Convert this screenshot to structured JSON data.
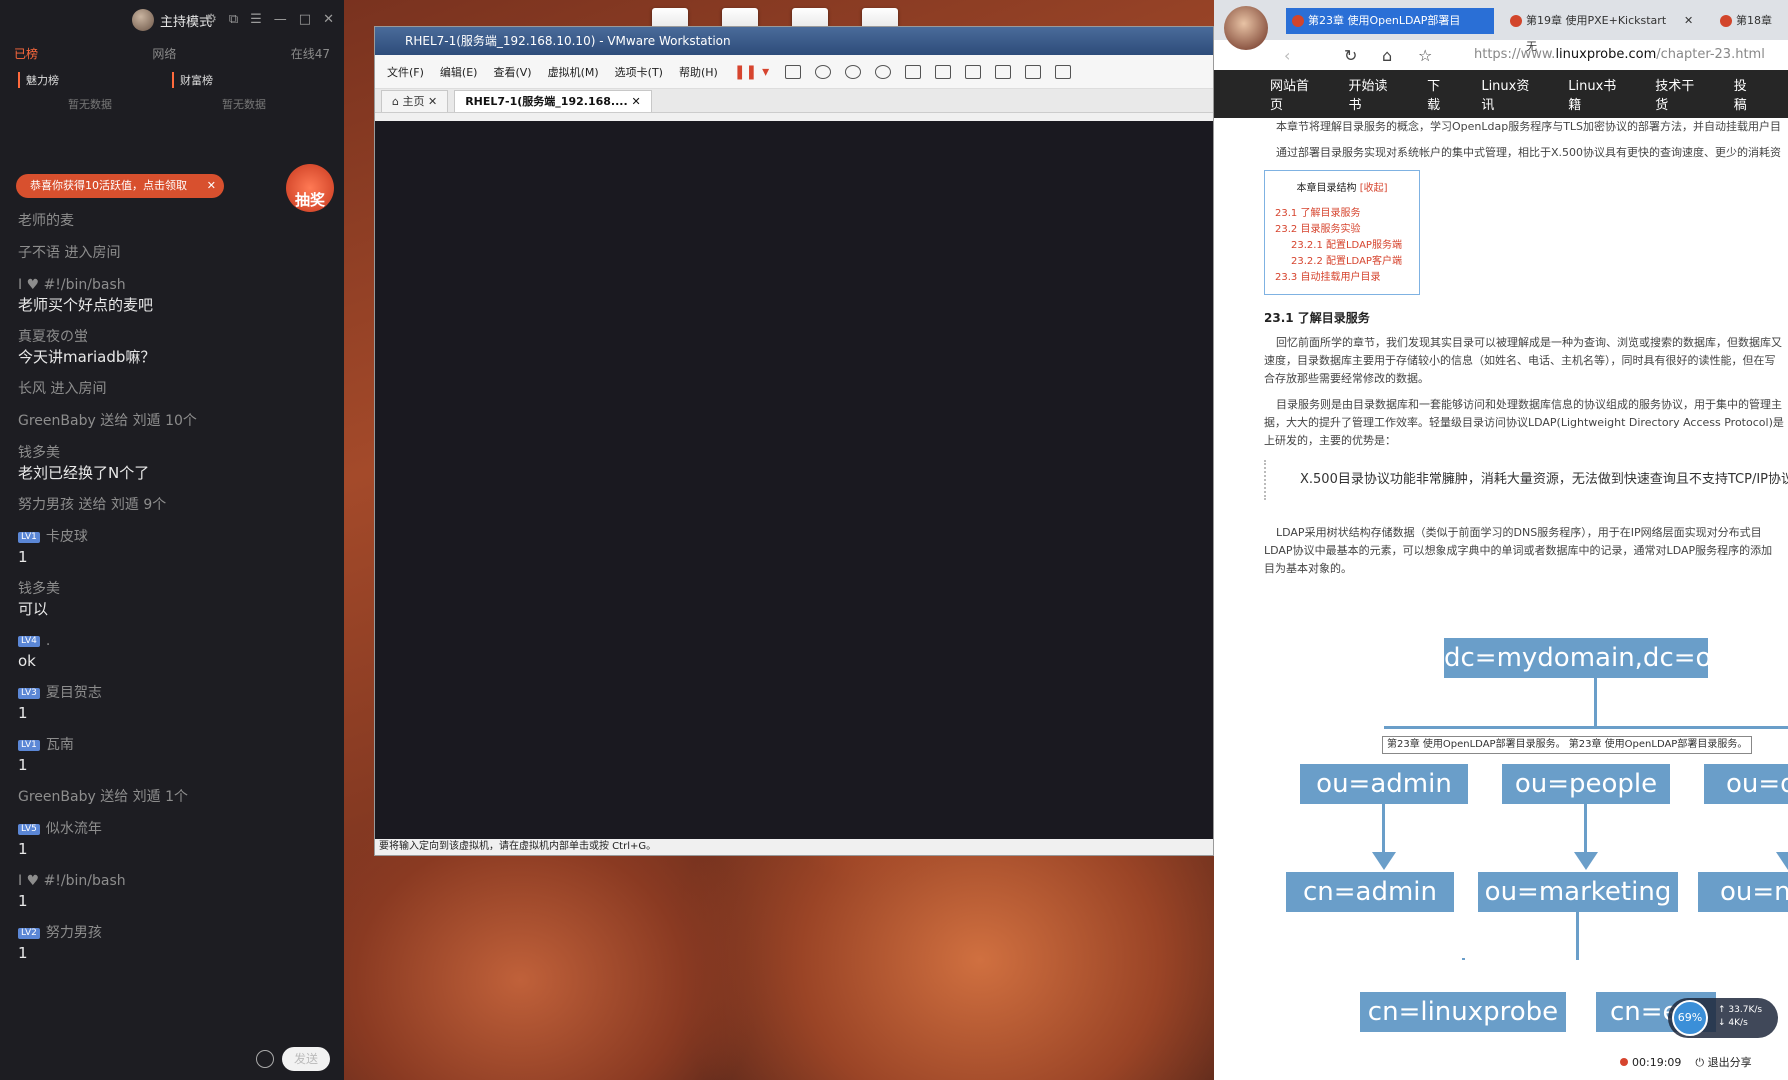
{
  "chat": {
    "title": "主持模式",
    "tabs": [
      "已榜",
      "网络",
      "在线47"
    ],
    "rank_left": "魅力榜",
    "rank_right": "财富榜",
    "rank_empty": "暂无数据",
    "notice": "恭喜你获得10活跃值，点击领取",
    "lottery": "抽奖",
    "messages": [
      {
        "who": "老师的麦",
        "text": ""
      },
      {
        "who": "子不语 进入房间",
        "text": ""
      },
      {
        "who": "I ♥ #!/bin/bash",
        "text": "老师买个好点的麦吧"
      },
      {
        "who": "真夏夜の蛍",
        "text": "今天讲mariadb嘛？"
      },
      {
        "who": "长风 进入房间",
        "text": ""
      },
      {
        "who": "GreenBaby 送给 刘遁 10个",
        "text": ""
      },
      {
        "who": "钱多美",
        "text": "老刘已经换了N个了"
      },
      {
        "who": "努力男孩 送给 刘遁 9个",
        "text": ""
      },
      {
        "who": "卡皮球",
        "lv": "LV1",
        "text": "1"
      },
      {
        "who": "钱多美",
        "text": "可以"
      },
      {
        "who": ".",
        "lv": "LV4",
        "text": "ok"
      },
      {
        "who": "夏目贺志",
        "lv": "LV3",
        "text": "1"
      },
      {
        "who": "瓦南",
        "lv": "LV1",
        "text": "1"
      },
      {
        "who": "GreenBaby 送给 刘遁 1个",
        "text": ""
      },
      {
        "who": "似水流年",
        "lv": "LV5",
        "text": "1"
      },
      {
        "who": "I ♥ #!/bin/bash",
        "text": "1"
      },
      {
        "who": "努力男孩",
        "lv": "LV2",
        "text": "1"
      }
    ],
    "send": "发送"
  },
  "vmware": {
    "title": "RHEL7-1(服务端_192.168.10.10) - VMware Workstation",
    "menu": [
      "文件(F)",
      "编辑(E)",
      "查看(V)",
      "虚拟机(M)",
      "选项卡(T)",
      "帮助(H)"
    ],
    "tabs": [
      "主页",
      "RHEL7-1(服务端_192.168...."
    ],
    "status": "要将输入定向到该虚拟机，请在虚拟机内部单击或按 Ctrl+G。"
  },
  "browser": {
    "tabs": [
      "第23章 使用OpenLDAP部署目",
      "第19章 使用PXE+Kickstart无",
      "第18章"
    ],
    "url_prefix": "https://www.",
    "url_domain": "linuxprobe.com",
    "url_suffix": "/chapter-23.html",
    "nav": [
      "网站首页",
      "开始读书",
      "下载",
      "Linux资讯",
      "Linux书籍",
      "技术干货",
      "投稿"
    ],
    "intro1": "本章节将理解目录服务的概念，学习OpenLdap服务程序与TLS加密协议的部署方法，并自动挂载用户目",
    "intro2": "通过部署目录服务实现对系统帐户的集中式管理，相比于X.500协议具有更快的查询速度、更少的消耗资",
    "toc_title": "本章目录结构",
    "toc_toggle": "[收起]",
    "toc": [
      "23.1 了解目录服务",
      "23.2 目录服务实验",
      "23.2.1 配置LDAP服务端",
      "23.2.2 配置LDAP客户端",
      "23.3 自动挂载用户目录"
    ],
    "section": "23.1 了解目录服务",
    "p1a": "回忆前面所学的章节，我们发现其实目录可以被理解成是一种为查询、浏览或搜索的数据库，但数据库又",
    "p1b": "速度，目录数据库主要用于存储较小的信息（如姓名、电话、主机名等），同时具有很好的读性能，但在写",
    "p1c": "合存放那些需要经常修改的数据。",
    "p2a": "目录服务则是由目录数据库和一套能够访问和处理数据库信息的协议组成的服务协议，用于集中的管理主",
    "p2b": "据，大大的提升了管理工作效率。轻量级目录访问协议LDAP(Lightweight Directory Access Protocol)是",
    "p2c": "上研发的，主要的优势是：",
    "quote": "X.500目录协议功能非常臃肿，消耗大量资源，无法做到快速查询且不支持TCP/IP协议",
    "p3a": "LDAP采用树状结构存储数据（类似于前面学习的DNS服务程序），用于在IP网络层面实现对分布式目",
    "p3b": "LDAP协议中最基本的元素，可以想象成字典中的单词或者数据库中的记录，通常对LDAP服务程序的添加",
    "p3c": "目为基本对象的。",
    "tree": {
      "root": "dc=mydomain,dc=org",
      "l1": [
        "ou=admin",
        "ou=people",
        "ou=d"
      ],
      "l2": [
        "cn=admin",
        "ou=marketing",
        "ou=n"
      ],
      "l3": [
        "cn=linuxprobe",
        "cn=e"
      ]
    },
    "tooltip": "第23章 使用OpenLDAP部署目录服务。 第23章 使用OpenLDAP部署目录服务。",
    "net_percent": "69%",
    "net_up": "33.7K/s",
    "net_down": "4K/s",
    "timer": "00:19:09",
    "exit": "退出分享"
  },
  "colors": {
    "accent": "#ff6a3d",
    "node": "#6a9ec9",
    "link": "#d6442e"
  }
}
